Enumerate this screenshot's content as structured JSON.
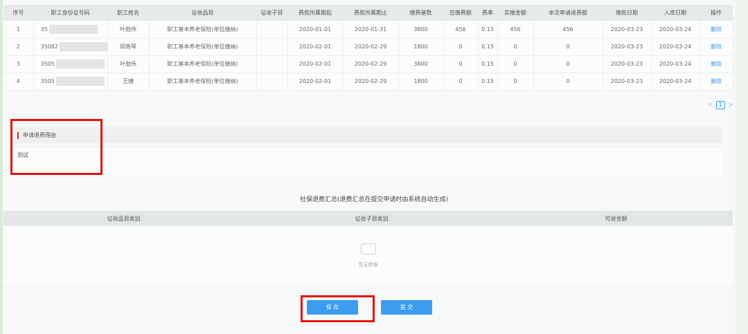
{
  "table": {
    "headers": [
      "序号",
      "职工身份证号码",
      "职工姓名",
      "征收品目",
      "征收子目",
      "费款所属期起",
      "费款所属期止",
      "缴费基数",
      "应缴费额",
      "费率",
      "实缴金额",
      "本次申请退费额",
      "缴款日期",
      "入库日期",
      "操作"
    ],
    "rows": [
      [
        "1",
        "35",
        "叶勋伟",
        "职工基本养老保险(单位缴纳)",
        "",
        "2020-01-01",
        "2020-01-31",
        "3800",
        "456",
        "0.15",
        "456",
        "456",
        "2020-03-23",
        "2020-03-24",
        "删除"
      ],
      [
        "2",
        "35082",
        "邱燕琴",
        "职工基本养老保险(单位缴纳)",
        "",
        "2020-02-01",
        "2020-02-29",
        "1800",
        "0",
        "0.15",
        "0",
        "0",
        "2020-03-23",
        "2020-03-24",
        "删除"
      ],
      [
        "3",
        "3505",
        "叶勋伟",
        "职工基本养老保险(单位缴纳)",
        "",
        "2020-02-01",
        "2020-02-29",
        "3800",
        "0",
        "0.15",
        "0",
        "0",
        "2020-03-23",
        "2020-03-24",
        "删除"
      ],
      [
        "4",
        "3505",
        "王捷",
        "职工基本养老保险(单位缴纳)",
        "",
        "2020-02-01",
        "2020-02-29",
        "1800",
        "0",
        "0.15",
        "0",
        "0",
        "2020-03-23",
        "2020-03-24",
        "删除"
      ]
    ]
  },
  "pager": {
    "prev": "<",
    "page": "1",
    "next": ">"
  },
  "reason": {
    "label": "申请退费理由",
    "value": "测试"
  },
  "summary": {
    "title": "社保退费汇总(退费汇总在提交申请时由系统自动生成)",
    "headers": [
      "征收品目类别",
      "征收子目类别",
      "可退金额"
    ],
    "empty": "暂无数据"
  },
  "buttons": {
    "save": "保 存",
    "submit": "提 交"
  }
}
